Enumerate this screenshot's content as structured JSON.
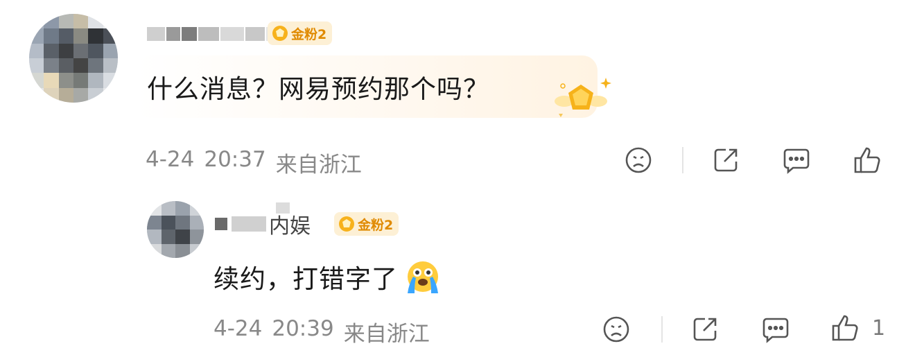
{
  "comments": [
    {
      "badge": "金粉2",
      "text": "什么消息？网易预约那个吗？",
      "date": "4-24",
      "time": "20:37",
      "location": "来自浙江",
      "likes": ""
    },
    {
      "name_visible": "内娱",
      "badge": "金粉2",
      "text": "续约，打错字了",
      "emoji": "cry-emoji",
      "date": "4-24",
      "time": "20:39",
      "location": "来自浙江",
      "likes": "1"
    }
  ],
  "icons": [
    "dislike-icon",
    "share-icon",
    "reply-icon",
    "like-icon",
    "gold-fan-badge-icon",
    "fan-bubble-decoration-icon"
  ],
  "colors": {
    "badge_bg": "#fdf0d5",
    "badge_text": "#e08a00",
    "meta": "#888888",
    "text": "#1a1a1a"
  }
}
